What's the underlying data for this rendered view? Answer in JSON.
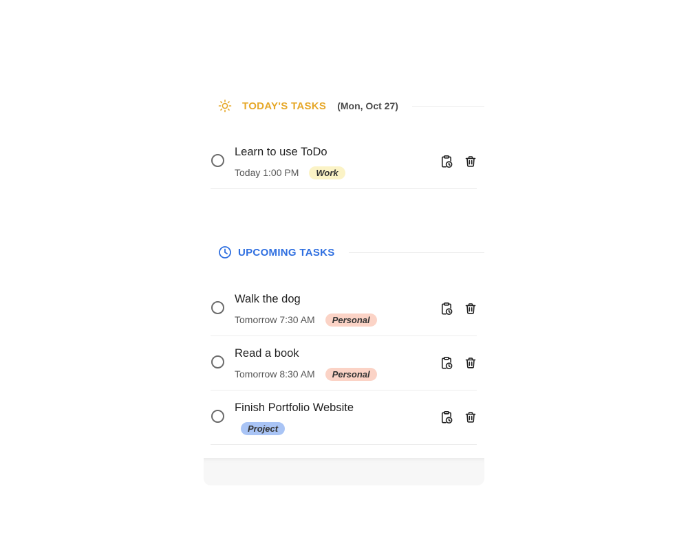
{
  "today": {
    "icon": "sun-icon",
    "title": "TODAY'S TASKS",
    "date": "(Mon, Oct 27)",
    "color": "#e6a82a",
    "tasks": [
      {
        "title": "Learn to use ToDo",
        "time": "Today 1:00 PM",
        "tag": "Work",
        "tag_color": "#fbf3c6",
        "completed": false
      }
    ]
  },
  "upcoming": {
    "icon": "clock-icon",
    "title": "UPCOMING TASKS",
    "color": "#2f6fe0",
    "tasks": [
      {
        "title": "Walk the dog",
        "time": "Tomorrow 7:30 AM",
        "tag": "Personal",
        "tag_color": "#fbd3c6",
        "completed": false
      },
      {
        "title": "Read a book",
        "time": "Tomorrow 8:30 AM",
        "tag": "Personal",
        "tag_color": "#fbd3c6",
        "completed": false
      },
      {
        "title": "Finish Portfolio Website",
        "time": "",
        "tag": "Project",
        "tag_color": "#a9c4f5",
        "completed": false
      }
    ]
  },
  "actions": {
    "reschedule_icon": "clipboard-clock-icon",
    "delete_icon": "trash-icon"
  }
}
